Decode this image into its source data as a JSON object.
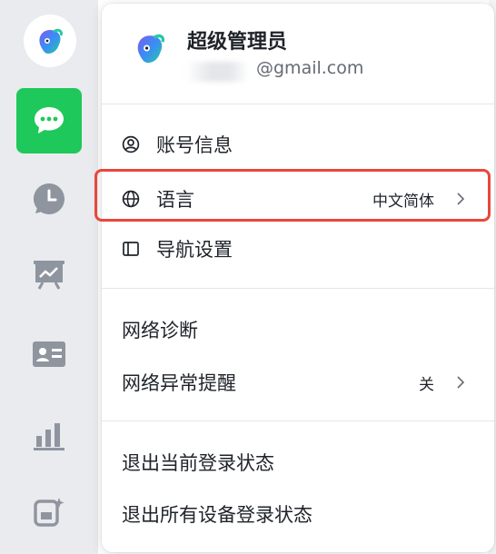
{
  "profile": {
    "name": "超级管理员",
    "email_visible": "@gmail.com"
  },
  "menu": {
    "account": {
      "label": "账号信息"
    },
    "language": {
      "label": "语言",
      "value": "中文简体"
    },
    "nav_settings": {
      "label": "导航设置"
    },
    "network_diag": {
      "label": "网络诊断"
    },
    "network_alert": {
      "label": "网络异常提醒",
      "value": "关"
    },
    "logout_current": {
      "label": "退出当前登录状态"
    },
    "logout_all": {
      "label": "退出所有设备登录状态"
    }
  },
  "colors": {
    "rail_bg": "#e9ebef",
    "active_green": "#1fc85a",
    "rail_icon": "#8f959e",
    "highlight_red": "#e8473b",
    "text_primary": "#1f2329",
    "text_secondary": "#646a73"
  },
  "icons": {
    "rail": [
      "avatar-icon",
      "chat-icon",
      "clock-icon",
      "board-icon",
      "contact-card-icon",
      "chart-icon",
      "workplace-icon"
    ],
    "menu": [
      "user-circle-icon",
      "globe-icon",
      "sidebar-icon",
      "chevron-right-icon"
    ]
  }
}
